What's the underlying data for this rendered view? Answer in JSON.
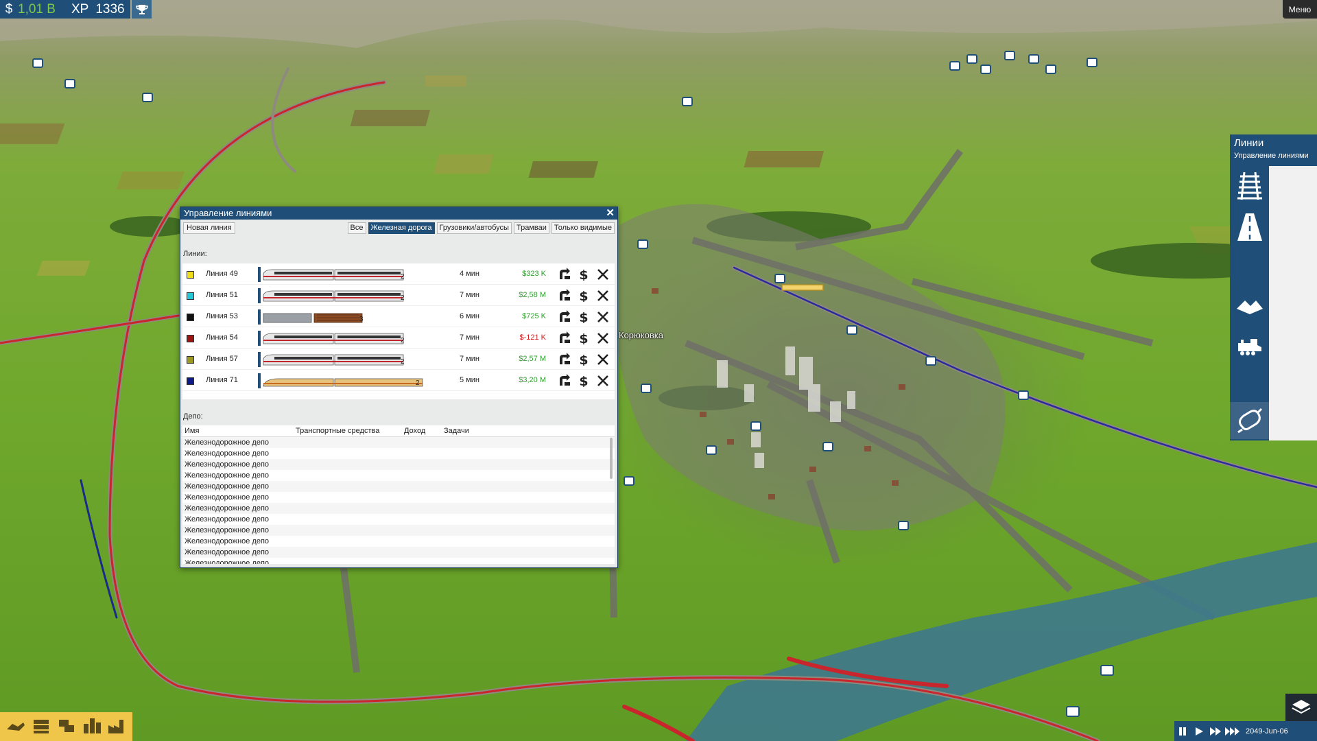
{
  "hud": {
    "currency_symbol": "$",
    "money": "1,01 B",
    "xp_label": "XP",
    "xp_value": "1336",
    "trophy_icon": "trophy-icon",
    "menu_label": "Меню"
  },
  "map_labels": {
    "town_name": "Корюковка"
  },
  "lines_window": {
    "title": "Управление линиями",
    "new_line_label": "Новая линия",
    "filters": [
      {
        "label": "Все",
        "active": false
      },
      {
        "label": "Железная дорога",
        "active": true
      },
      {
        "label": "Грузовики/автобусы",
        "active": false
      },
      {
        "label": "Трамваи",
        "active": false
      },
      {
        "label": "Только видимые",
        "active": false
      }
    ],
    "lines_label": "Линии:",
    "lines": [
      {
        "name": "Линия 49",
        "color": "#f1dc1a",
        "time": "4 мин",
        "profit": "$323 K",
        "profit_color": "#2e9e2e",
        "train": "emu",
        "count_label": "2"
      },
      {
        "name": "Линия 51",
        "color": "#22c7d8",
        "time": "7 мин",
        "profit": "$2,58 M",
        "profit_color": "#2e9e2e",
        "train": "emu",
        "count_label": "2"
      },
      {
        "name": "Линия 53",
        "color": "#111111",
        "time": "6 мин",
        "profit": "$725 K",
        "profit_color": "#2e9e2e",
        "train": "freight",
        "count_label": "3"
      },
      {
        "name": "Линия 54",
        "color": "#9a1414",
        "time": "7 мин",
        "profit": "$-121 K",
        "profit_color": "#d22020",
        "train": "emu",
        "count_label": "2"
      },
      {
        "name": "Линия 57",
        "color": "#9b9a1e",
        "time": "7 мин",
        "profit": "$2,57 M",
        "profit_color": "#2e9e2e",
        "train": "emu",
        "count_label": "2"
      },
      {
        "name": "Линия 71",
        "color": "#0e1a8a",
        "time": "5 мин",
        "profit": "$3,20 M",
        "profit_color": "#2e9e2e",
        "train": "hsr",
        "count_label": "2"
      }
    ],
    "depot_label": "Депо:",
    "depot_columns": {
      "name": "Имя",
      "vehicles": "Транспортные средства",
      "income": "Доход",
      "tasks": "Задачи"
    },
    "depots": [
      "Железнодорожное депо",
      "Железнодорожное депо",
      "Железнодорожное депо",
      "Железнодорожное депо",
      "Железнодорожное депо",
      "Железнодорожное депо",
      "Железнодорожное депо",
      "Железнодорожное депо",
      "Железнодорожное депо",
      "Железнодорожное депо",
      "Железнодорожное депо",
      "Железнодорожное депо"
    ]
  },
  "right_panel": {
    "title": "Линии",
    "subtitle": "Управление линиями",
    "buttons": [
      "rail-track-icon",
      "road-icon",
      "terrain-icon",
      "locomotive-icon",
      "lines-icon"
    ]
  },
  "bottom_toolbar": {
    "icons": [
      "bulldozer-icon",
      "train-depot-icon",
      "bus-stop-icon",
      "city-icon",
      "industry-icon"
    ]
  },
  "time_controls": {
    "date": "2049-Jun-06",
    "buttons": [
      "pause-icon",
      "play-icon",
      "fast-icon",
      "fastest-icon"
    ]
  }
}
